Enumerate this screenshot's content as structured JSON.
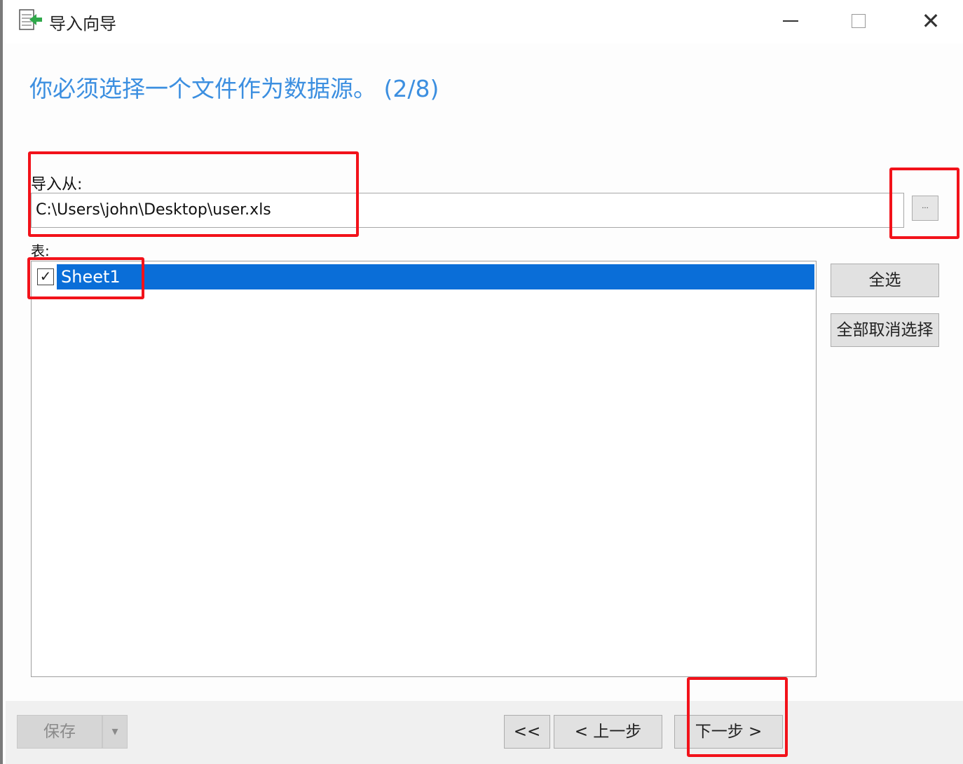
{
  "window": {
    "title": "导入向导",
    "icon": "import-wizard-icon",
    "controls": {
      "minimize": "minimize-icon",
      "maximize": "maximize-icon",
      "close": "✕"
    }
  },
  "heading": "你必须选择一个文件作为数据源。 (2/8)",
  "import_from": {
    "label": "导入从:",
    "value": "C:\\Users\\john\\Desktop\\user.xls",
    "browse_label": "..."
  },
  "tables": {
    "label": "表:",
    "items": [
      {
        "label": "Sheet1",
        "checked": true,
        "selected": true,
        "check_mark": "✓"
      }
    ],
    "select_all": "全选",
    "deselect_all": "全部取消选择"
  },
  "footer": {
    "save": "保存",
    "save_dropdown": "▾",
    "first": "<<",
    "prev": "< 上一步",
    "next": "下一步 >"
  },
  "colors": {
    "heading": "#3c8fe0",
    "selection": "#0a6ed8",
    "annotation": "#f2121a"
  }
}
